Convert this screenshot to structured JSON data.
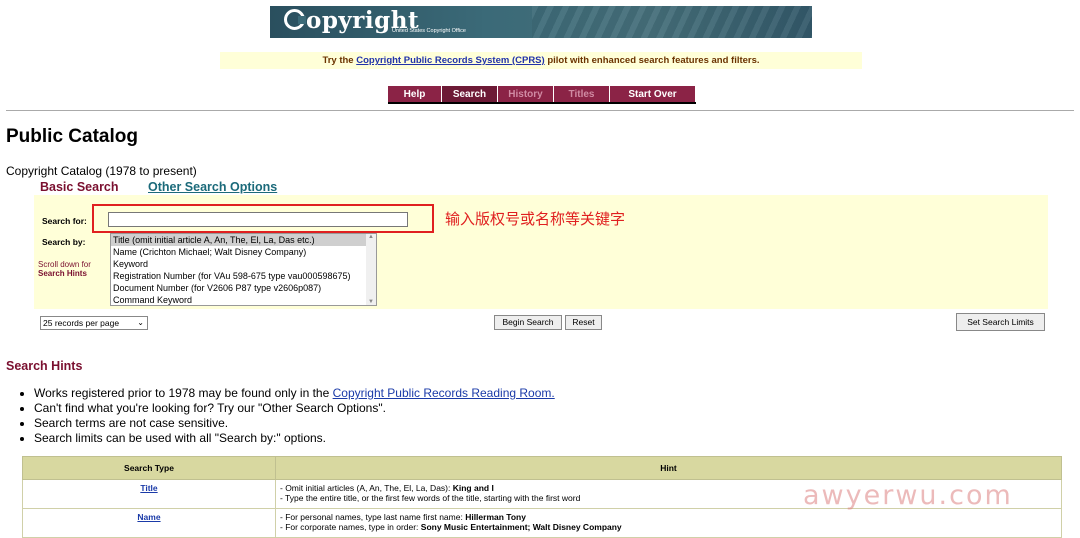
{
  "banner": {
    "logo": "opyright",
    "subtitle": "United States Copyright Office"
  },
  "notice": {
    "prefix": "Try the ",
    "link": "Copyright Public Records System (CPRS)",
    "suffix": " pilot with enhanced search features and filters."
  },
  "nav": {
    "help": "Help",
    "search": "Search",
    "history": "History",
    "titles": "Titles",
    "start_over": "Start Over"
  },
  "page_title": "Public Catalog",
  "catalog_label": "Copyright Catalog (1978 to present)",
  "tabs": {
    "basic": "Basic Search",
    "other": "Other Search Options"
  },
  "form": {
    "search_for_label": "Search for:",
    "search_for_value": "",
    "search_by_label": "Search by:",
    "scroll_hint_1": "Scroll down for",
    "scroll_hint_2": "Search Hints",
    "search_by_options": [
      "Title (omit initial article A, An, The, El, La, Das etc.)",
      "Name (Crichton Michael; Walt Disney Company)",
      "Keyword",
      "Registration Number (for VAu 598-675 type vau000598675)",
      "Document Number (for V2606 P87 type v2606p087)",
      "Command Keyword"
    ],
    "records_per_page": "25 records per page",
    "begin_search": "Begin Search",
    "reset": "Reset",
    "set_limits": "Set Search Limits"
  },
  "annotation": "输入版权号或名称等关键字",
  "hints": {
    "title": "Search Hints",
    "items": [
      {
        "text": "Works registered prior to 1978 may be found only in the ",
        "link": "Copyright Public Records Reading Room."
      },
      {
        "text": "Can't find what you're looking for? Try our \"Other Search Options\".",
        "link": ""
      },
      {
        "text": "Search terms are not case sensitive.",
        "link": ""
      },
      {
        "text": "Search limits can be used with all \"Search by:\" options.",
        "link": ""
      }
    ]
  },
  "hint_table": {
    "headers": [
      "Search Type",
      "Hint"
    ],
    "rows": [
      {
        "type": "Title",
        "line1_pre": "- Omit initial articles (A, An, The, El, La, Das): ",
        "line1_bold": "King and I",
        "line2_pre": "- Type the entire title, or the first few words of the title, starting with the first word",
        "line2_bold": ""
      },
      {
        "type": "Name",
        "line1_pre": "- For personal names, type last name first name: ",
        "line1_bold": "Hillerman Tony",
        "line2_pre": "- For corporate names, type in order: ",
        "line2_bold": "Sony Music Entertainment; Walt Disney Company"
      }
    ]
  },
  "watermark": "awyerwu.com"
}
